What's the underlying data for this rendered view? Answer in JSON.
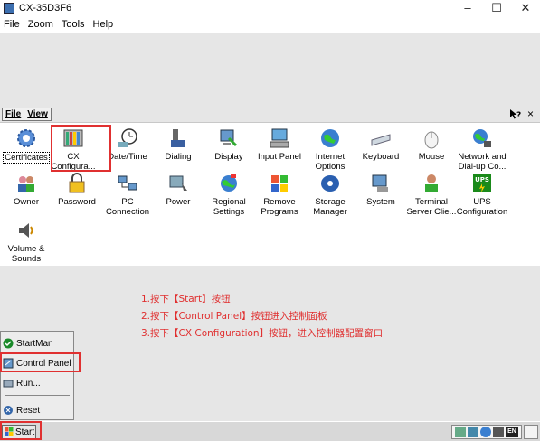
{
  "window": {
    "title": "CX-35D3F6",
    "minimize": "–",
    "maximize": "☐",
    "close": "✕"
  },
  "host_menu": [
    "File",
    "Zoom",
    "Tools",
    "Help"
  ],
  "control_panel": {
    "menu": [
      "File",
      "View"
    ],
    "help_label": "?",
    "close_label": "×",
    "items": [
      {
        "label": "Certificates",
        "icon": "gear-icon"
      },
      {
        "label": "CX\nConfigura...",
        "icon": "module-rack-icon"
      },
      {
        "label": "Date/Time",
        "icon": "clock-icon"
      },
      {
        "label": "Dialing",
        "icon": "phone-icon"
      },
      {
        "label": "Display",
        "icon": "display-icon"
      },
      {
        "label": "Input Panel",
        "icon": "keyboard-panel-icon"
      },
      {
        "label": "Internet\nOptions",
        "icon": "globe-icon"
      },
      {
        "label": "Keyboard",
        "icon": "keyboard-icon"
      },
      {
        "label": "Mouse",
        "icon": "mouse-icon"
      },
      {
        "label": "Network and\nDial-up Co...",
        "icon": "network-icon"
      },
      {
        "label": "Owner",
        "icon": "users-icon"
      },
      {
        "label": "Password",
        "icon": "lock-icon"
      },
      {
        "label": "PC\nConnection",
        "icon": "pc-connection-icon"
      },
      {
        "label": "Power",
        "icon": "power-icon"
      },
      {
        "label": "Regional\nSettings",
        "icon": "regional-icon"
      },
      {
        "label": "Remove\nPrograms",
        "icon": "remove-programs-icon"
      },
      {
        "label": "Storage\nManager",
        "icon": "storage-icon"
      },
      {
        "label": "System",
        "icon": "system-icon"
      },
      {
        "label": "Terminal\nServer Clie...",
        "icon": "terminal-icon"
      },
      {
        "label": "UPS\nConfiguration",
        "icon": "ups-icon"
      },
      {
        "label": "Volume &\nSounds",
        "icon": "volume-icon"
      }
    ]
  },
  "instructions": [
    "1.按下【Start】按钮",
    "2.按下【Control Panel】按钮进入控制面板",
    "3.按下【CX Configuration】按钮，进入控制器配置窗口"
  ],
  "start_menu": {
    "items": [
      {
        "label": "StartMan",
        "icon": "startman-icon"
      },
      {
        "label": "Control Panel",
        "icon": "control-panel-icon"
      },
      {
        "label": "Run...",
        "icon": "run-icon"
      },
      {
        "label": "Reset",
        "icon": "reset-icon"
      }
    ]
  },
  "taskbar": {
    "start_label": "Start",
    "tray_lang": "EN"
  },
  "colors": {
    "highlight": "#e03030",
    "instruction_text": "#e03030"
  }
}
